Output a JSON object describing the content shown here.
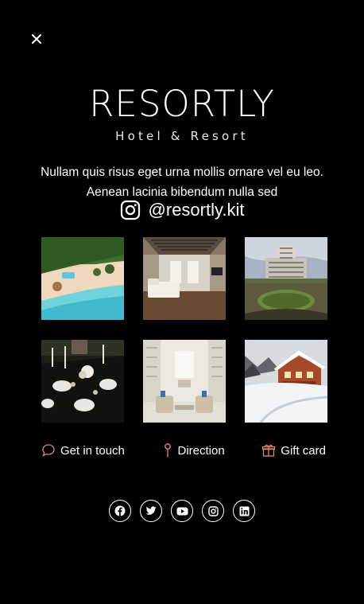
{
  "brand": {
    "name": "RESORTLY",
    "tagline": "Hotel & Resort"
  },
  "description": "Nullam quis risus eget urna mollis ornare vel eu leo. Aenean lacinia bibendum nulla sed",
  "instagram": {
    "handle": "@resortly.kit",
    "icon": "instagram-icon"
  },
  "gallery": [
    {
      "icon": "beach-resort-photo"
    },
    {
      "icon": "hotel-bedroom-photo"
    },
    {
      "icon": "hotel-building-photo"
    },
    {
      "icon": "dining-table-photo"
    },
    {
      "icon": "lounge-interior-photo"
    },
    {
      "icon": "snowy-chalet-photo"
    }
  ],
  "actions": [
    {
      "label": "Get in touch",
      "icon": "chat-bubble-icon"
    },
    {
      "label": "Direction",
      "icon": "map-pin-icon"
    },
    {
      "label": "Gift card",
      "icon": "gift-icon"
    }
  ],
  "socials": [
    "facebook-icon",
    "twitter-icon",
    "youtube-icon",
    "instagram-icon",
    "linkedin-icon"
  ],
  "colors": {
    "background": "#000000",
    "text": "#ffffff",
    "accent": "#e0876a"
  }
}
